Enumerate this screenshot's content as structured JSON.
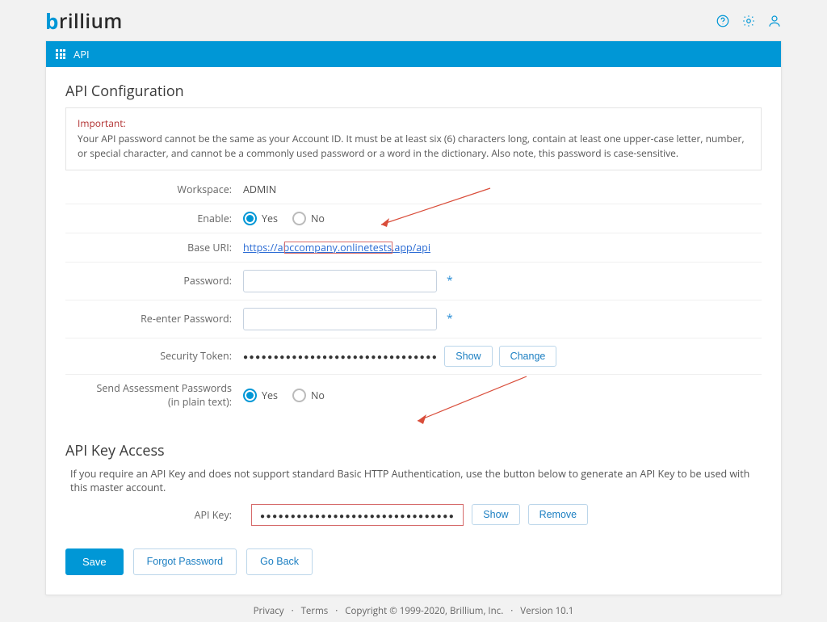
{
  "brand": "rillium",
  "section_bar": {
    "title": "API"
  },
  "config": {
    "heading": "API Configuration",
    "important_label": "Important:",
    "important_text": "Your API password cannot be the same as your Account ID. It must be at least six (6) characters long, contain at least one upper-case letter, number, or special character, and cannot be a commonly used password or a word in the dictionary. Also note, this password is case-sensitive.",
    "rows": {
      "workspace": {
        "label": "Workspace:",
        "value": "ADMIN"
      },
      "enable": {
        "label": "Enable:",
        "yes": "Yes",
        "no": "No",
        "selected": "yes"
      },
      "base_uri": {
        "label": "Base URI:",
        "value": "https://abccompany.onlinetests.app/api"
      },
      "password": {
        "label": "Password:",
        "value": ""
      },
      "reenter": {
        "label": "Re-enter Password:",
        "value": ""
      },
      "token": {
        "label": "Security Token:",
        "mask": "●●●●●●●●●●●●●●●●●●●●●●●●●●●●●●●●",
        "show": "Show",
        "change": "Change"
      },
      "send_pw": {
        "label1": "Send Assessment Passwords",
        "label2": "(in plain text):",
        "yes": "Yes",
        "no": "No",
        "selected": "yes"
      }
    }
  },
  "access": {
    "heading": "API Key Access",
    "desc": "If you require an API Key and does not support standard Basic HTTP Authentication, use the button below to generate an API Key to be used with this master account.",
    "key": {
      "label": "API Key:",
      "mask": "●●●●●●●●●●●●●●●●●●●●●●●●●●●●●●●●"
    },
    "show": "Show",
    "remove": "Remove"
  },
  "actions": {
    "save": "Save",
    "forgot": "Forgot Password",
    "back": "Go Back"
  },
  "footer": {
    "privacy": "Privacy",
    "terms": "Terms",
    "copyright": "Copyright © 1999-2020, Brillium, Inc.",
    "version": "Version 10.1",
    "sep": "·"
  }
}
